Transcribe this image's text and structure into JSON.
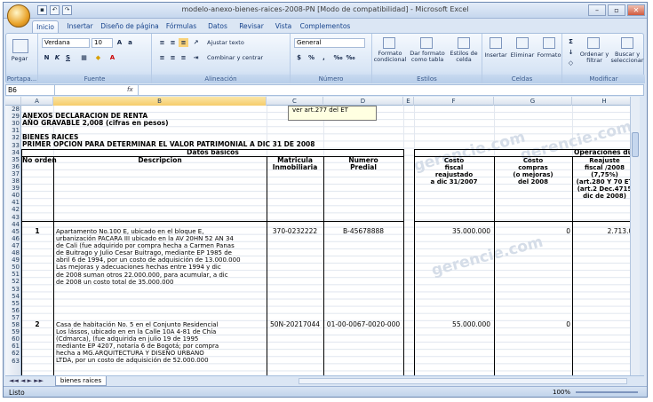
{
  "window": {
    "title": "modelo-anexo-bienes-raices-2008-PN  [Modo de compatibilidad] - Microsoft Excel"
  },
  "tabs": [
    "Inicio",
    "Insertar",
    "Diseño de página",
    "Fórmulas",
    "Datos",
    "Revisar",
    "Vista",
    "Complementos"
  ],
  "ribbon": {
    "font_name": "Verdana",
    "font_size": "10",
    "number_format": "General",
    "paste": "Pegar",
    "wrap_text": "Ajustar texto",
    "merge_center": "Combinar y centrar",
    "cond_format": "Formato condicional",
    "format_table": "Dar formato como tabla",
    "cell_styles": "Estilos de celda",
    "insert": "Insertar",
    "delete": "Eliminar",
    "format": "Formato",
    "sort_filter": "Ordenar y filtrar",
    "find_select": "Buscar y seleccionar",
    "groups": [
      "Portapa...",
      "Fuente",
      "Alineación",
      "Número",
      "Estilos",
      "Celdas",
      "Modificar"
    ]
  },
  "formula_bar": {
    "name_box": "B6",
    "fx": "fx"
  },
  "columns": [
    "A",
    "B",
    "C",
    "D",
    "E",
    "F",
    "G",
    "H"
  ],
  "rows": [
    "28",
    "29",
    "30",
    "31",
    "32",
    "33",
    "34",
    "35",
    "36",
    "37",
    "38",
    "39",
    "40",
    "41",
    "42",
    "43",
    "44",
    "45",
    "46",
    "47",
    "48",
    "49",
    "50",
    "51",
    "52",
    "53",
    "54",
    "55",
    "56",
    "57",
    "58",
    "59",
    "60",
    "61",
    "62",
    "63"
  ],
  "sheet": {
    "comment": "ver art.277 del ET",
    "title1": "ANEXOS DECLARACION DE RENTA",
    "title2": "AÑO GRAVABLE 2,008 (cifras en pesos)",
    "title3": "BIENES RAICES",
    "title4": "PRIMER OPCION PARA DETERMINAR EL VALOR PATRIMONIAL A DIC 31 DE 2008",
    "header_basic": "Datos basicos",
    "header_ops": "Operaciones dur",
    "col_no": "No orden",
    "col_desc": "Descripcion",
    "col_matricula": "Matricula Inmobiliaria",
    "col_predial": "Numero Predial",
    "col_costo_fiscal": [
      "Costo",
      "fiscal",
      "reajustado",
      "a dic 31/2007"
    ],
    "col_costo_compras": [
      "Costo",
      "compras",
      "(o mejoras)",
      "del 2008"
    ],
    "col_reajuste": [
      "Reajuste",
      "fiscal /2008",
      "(7,75%)",
      "(art.280 Y 70 ET",
      "(art.2 Dec.4715",
      "dic de 2008)"
    ],
    "watermark": "gerencie.com",
    "items": [
      {
        "no": "1",
        "desc": [
          "Apartamento No.100 E, ubicado en el bloque E,",
          "urbanización PACARA III ubicado en la AV 20HN  52 AN 34",
          "de Cali (fue adquirido por compra hecha a  Carmen Panas",
          "de Buitrago y Julio Cesar Buitrago, mediante EP 1985 de",
          "abril 6 de 1994, por un costo de adquisición de 13.000.000",
          "Las mejoras y adecuaciones hechas entre 1994 y dic",
          "de 2008 suman otros 22.000.000, para acumular, a dic",
          "de 2008 un costo total de 35.000.000"
        ],
        "matricula": "370-0232222",
        "predial": "B-45678888",
        "costo_fiscal": "35.000.000",
        "compras": "0",
        "reajuste": "2.713.00"
      },
      {
        "no": "2",
        "desc": [
          "Casa de habitación No. 5 en el Conjunto Residencial",
          "Los lássos, ubicado en en la Calle 10A   4-81 de Chía",
          "(Cdmarca), (fue adquirida en julio 19 de 1995",
          "mediante EP 4207, notaría 6 de Bogotá; por compra",
          "hecha a  MG.ARQUITECTURA Y DISEÑO URBANO",
          "LTDA, por un costo de adquisición de 52.000.000"
        ],
        "matricula": "50N-20217044",
        "predial": "01-00-0067-0020-000",
        "costo_fiscal": "55.000.000",
        "compras": "0",
        "reajuste": ""
      }
    ]
  },
  "sheet_tab": "bienes raices",
  "status": {
    "left": "Listo",
    "zoom": "100%"
  }
}
